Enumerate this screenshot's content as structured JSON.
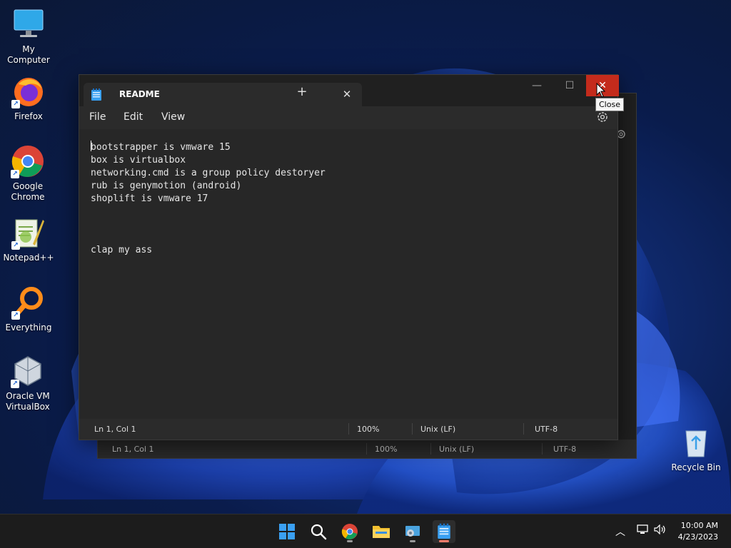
{
  "desktop": {
    "icons": [
      {
        "label": "My Computer"
      },
      {
        "label": "Firefox"
      },
      {
        "label": "Google Chrome"
      },
      {
        "label": "Notepad++"
      },
      {
        "label": "Everything"
      },
      {
        "label": "Oracle VM VirtualBox"
      },
      {
        "label": "Recycle Bin"
      }
    ]
  },
  "window": {
    "tab_title": "README",
    "tab_close": "✕",
    "new_tab": "+",
    "minimize": "—",
    "maximize": "☐",
    "close": "✕",
    "menu": [
      "File",
      "Edit",
      "View"
    ],
    "editor_lines": [
      "bootstrapper is vmware 15",
      "box is virtualbox",
      "networking.cmd is a group policy destoryer",
      "rub is genymotion (android)",
      "shoplift is vmware 17",
      "",
      "",
      "",
      "clap my ass"
    ],
    "status": {
      "position": "Ln 1, Col 1",
      "zoom": "100%",
      "line_ending": "Unix (LF)",
      "encoding": "UTF-8"
    }
  },
  "back_window": {
    "status": {
      "position": "Ln 1, Col 1",
      "zoom": "100%",
      "line_ending": "Unix (LF)",
      "encoding": "UTF-8"
    }
  },
  "tooltip": "Close",
  "taskbar": {
    "time": "10:00 AM",
    "date": "4/23/2023"
  },
  "colors": {
    "close_red": "#c42b1c",
    "notepad_accent": "#1e90ff"
  }
}
